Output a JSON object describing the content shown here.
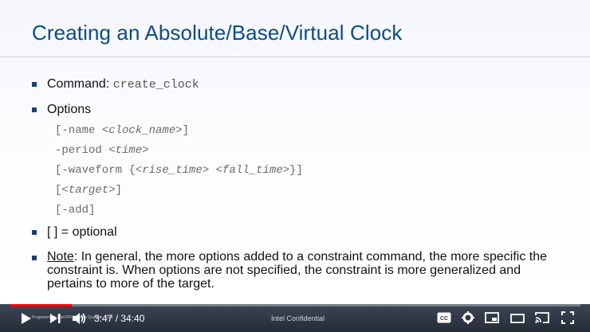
{
  "slide": {
    "title": "Creating an Absolute/Base/Virtual Clock",
    "command_label": "Command: ",
    "command_value": "create_clock",
    "options_label": "Options",
    "options": {
      "name_open": "[-name ",
      "name_arg": "<clock_name>",
      "name_close": "]",
      "period": "-period ",
      "period_arg": "<time>",
      "waveform_open": "[-waveform {",
      "waveform_arg1": "<rise_time>",
      "waveform_space": " ",
      "waveform_arg2": "<fall_time>",
      "waveform_close": "}]",
      "target_open": "[",
      "target_arg": "<target>",
      "target_close": "]",
      "add": "[-add]"
    },
    "optional_label": "[ ] = optional",
    "note_label": "Note",
    "note_text": ":  In general, the more options added to a constraint command, the more specific the constraint is.  When options are not specified, the constraint is more generalized and pertains to more of the target."
  },
  "player": {
    "current_time": "3:47",
    "separator": " / ",
    "duration": "34:40",
    "chapter_text": "Programming Intel FPGAs with Quartus... Sec",
    "footer_text": "Intel Confidential",
    "progress_fraction": 0.109,
    "icons": [
      "play-icon",
      "next-icon",
      "volume-icon",
      "captions-icon",
      "settings-icon",
      "miniplayer-icon",
      "theater-icon",
      "cast-icon",
      "fullscreen-icon"
    ],
    "accent_color": "#ff0000"
  }
}
